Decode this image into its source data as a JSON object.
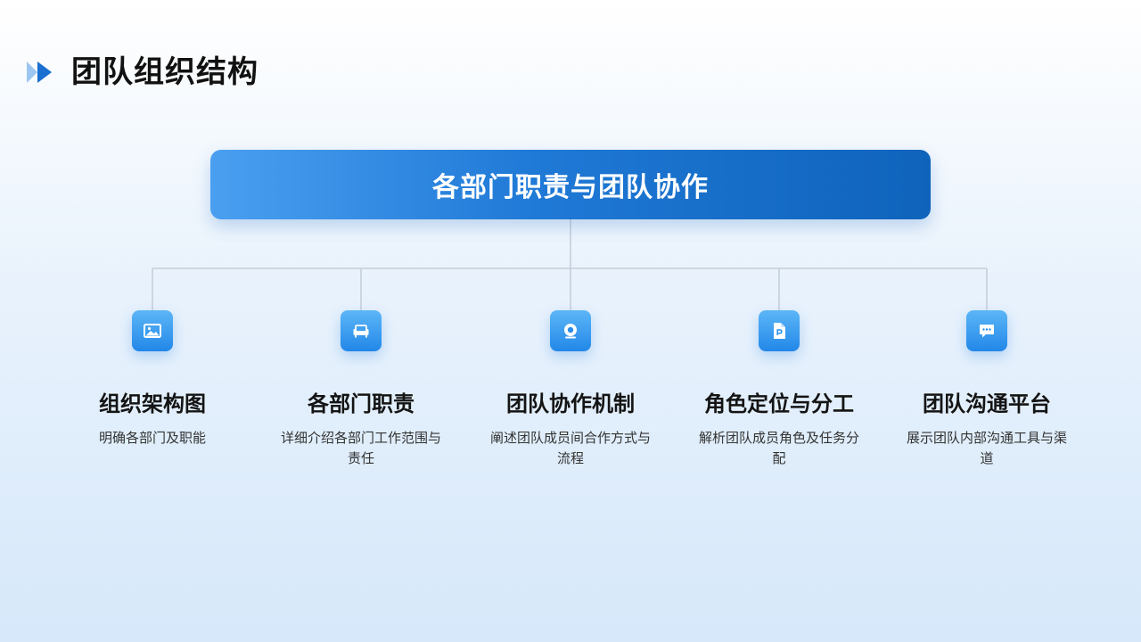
{
  "header": {
    "title": "团队组织结构"
  },
  "diagram": {
    "root": {
      "label": "各部门职责与团队协作"
    },
    "children": [
      {
        "icon": "image-icon",
        "title": "组织架构图",
        "description": "明确各部门及职能"
      },
      {
        "icon": "sofa-icon",
        "title": "各部门职责",
        "description": "详细介绍各部门工作范围与责任"
      },
      {
        "icon": "webcam-icon",
        "title": "团队协作机制",
        "description": "阐述团队成员间合作方式与流程"
      },
      {
        "icon": "document-p-icon",
        "title": "角色定位与分工",
        "description": "解析团队成员角色及任务分配"
      },
      {
        "icon": "chat-bubble-icon",
        "title": "团队沟通平台",
        "description": "展示团队内部沟通工具与渠道"
      }
    ]
  },
  "colors": {
    "accent": "#1f79d6",
    "icon_tile": "#3a9cef",
    "connector": "#c3cdd8"
  }
}
